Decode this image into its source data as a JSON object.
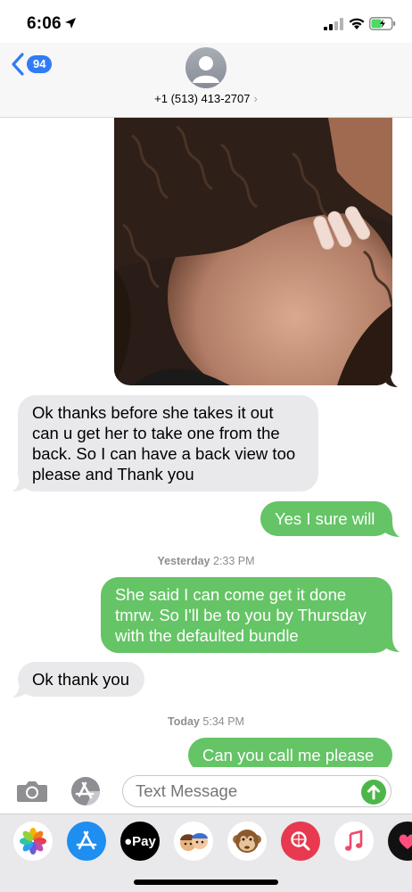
{
  "status_bar": {
    "time": "6:06"
  },
  "header": {
    "back_count": "94",
    "contact": "+1 (513) 413-2707",
    "chevron": "›"
  },
  "messages": {
    "m1": "Ok thanks before she takes it out\ncan u get her to take one from the\nback. So I can have a back view too\nplease and Thank you",
    "m2": "Yes I sure will",
    "ts1_day": "Yesterday",
    "ts1_time": "2:33 PM",
    "m3": "She said I can come get it done\ntmrw. So I'll be to you by Thursday\nwith the defaulted bundle",
    "m4": "Ok thank you",
    "ts2_day": "Today",
    "ts2_time": "5:34 PM",
    "m5": "Can you call me please"
  },
  "input": {
    "placeholder": "Text Message"
  },
  "apps": {
    "apple_pay_label": "Pay"
  },
  "colors": {
    "sent_bubble": "#65c466",
    "received_bubble": "#e9e9eb",
    "accent_blue": "#2f7cf6"
  },
  "icons": [
    "location-arrow-icon",
    "signal-icon",
    "wifi-icon",
    "battery-icon",
    "back-chevron-icon",
    "camera-icon",
    "app-store-icon",
    "send-arrow-icon",
    "photos-icon",
    "apple-pay-icon",
    "memoji-icon",
    "animoji-icon",
    "web-search-icon",
    "music-icon",
    "heart-icon"
  ]
}
